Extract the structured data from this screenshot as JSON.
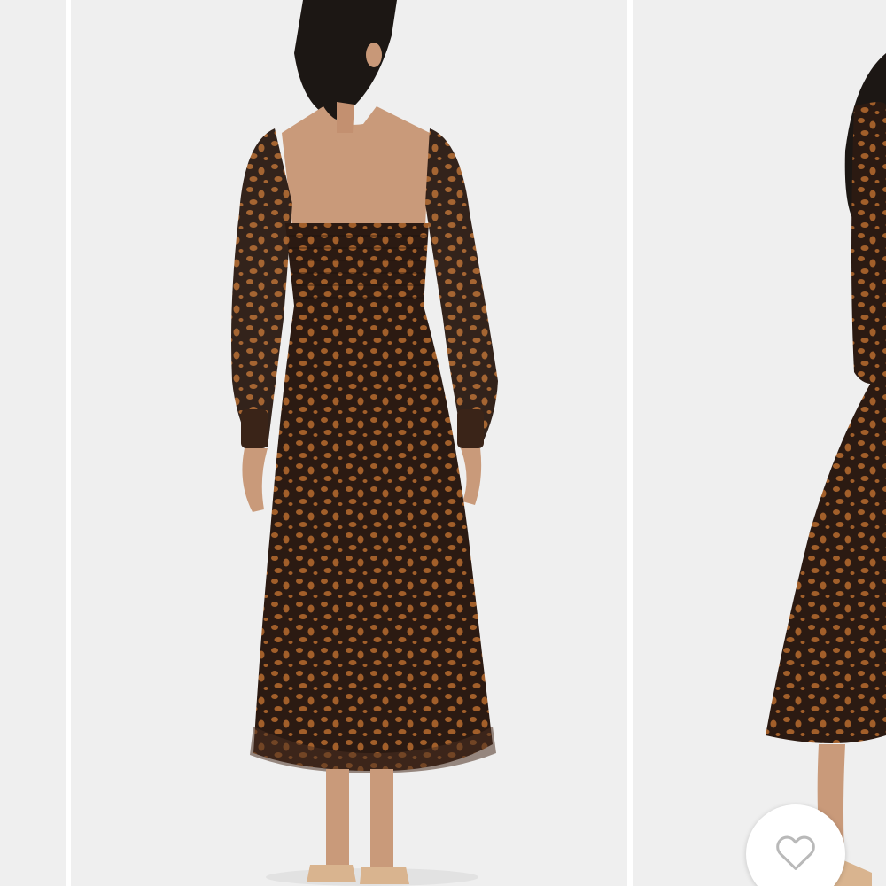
{
  "gallery": {
    "slides": [
      {
        "id": "previous",
        "image": "photo-placeholder"
      },
      {
        "id": "current",
        "image": "dress-back-view-photo"
      },
      {
        "id": "next",
        "image": "dress-side-view-photo"
      }
    ]
  },
  "like": {
    "icon": "heart-outline-icon",
    "icon_color": "#b9b9b9"
  },
  "colors": {
    "backdrop": "#efefef",
    "dress_base": "#2b1a12",
    "dress_spots": "#a25f2a",
    "skin": "#c99a7a",
    "hair": "#1c1714"
  }
}
